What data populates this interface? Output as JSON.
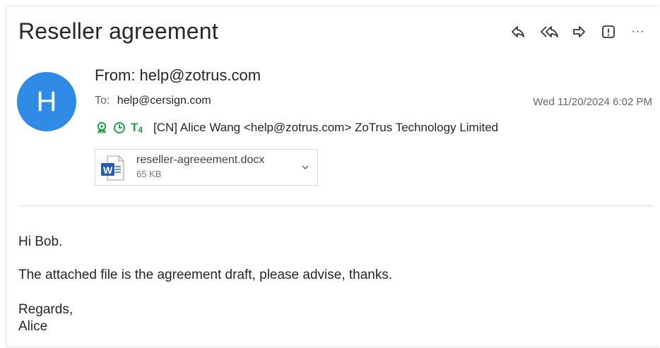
{
  "email": {
    "subject": "Reseller agreement",
    "avatar_initial": "H",
    "from_line": "From:  help@zotrus.com",
    "to_label": "To:",
    "to_value": "help@cersign.com",
    "date": "Wed 11/20/2024 6:02 PM",
    "cert_line": "[CN] Alice Wang <help@zotrus.com> ZoTrus Technology Limited",
    "cert_icons": [
      "verified-badge-icon",
      "clock-icon",
      "t4-badge-icon"
    ],
    "cert_badge_text": "T",
    "cert_badge_sub": "4",
    "accent_color": "#2f8be6",
    "cert_color": "#1fa347"
  },
  "toolbar": {
    "icons": [
      "reply-icon",
      "reply-all-icon",
      "forward-icon",
      "important-icon",
      "more-icon"
    ],
    "more_label": "···"
  },
  "attachment": {
    "name": "reseller-agreeement.docx",
    "size": "65 KB",
    "type_icon": "word-document-icon",
    "type_letter": "W"
  },
  "body": {
    "greeting": "Hi Bob.",
    "message": "The attached file is the agreement draft, please advise, thanks.",
    "closing": "Regards,",
    "signature": "Alice"
  }
}
